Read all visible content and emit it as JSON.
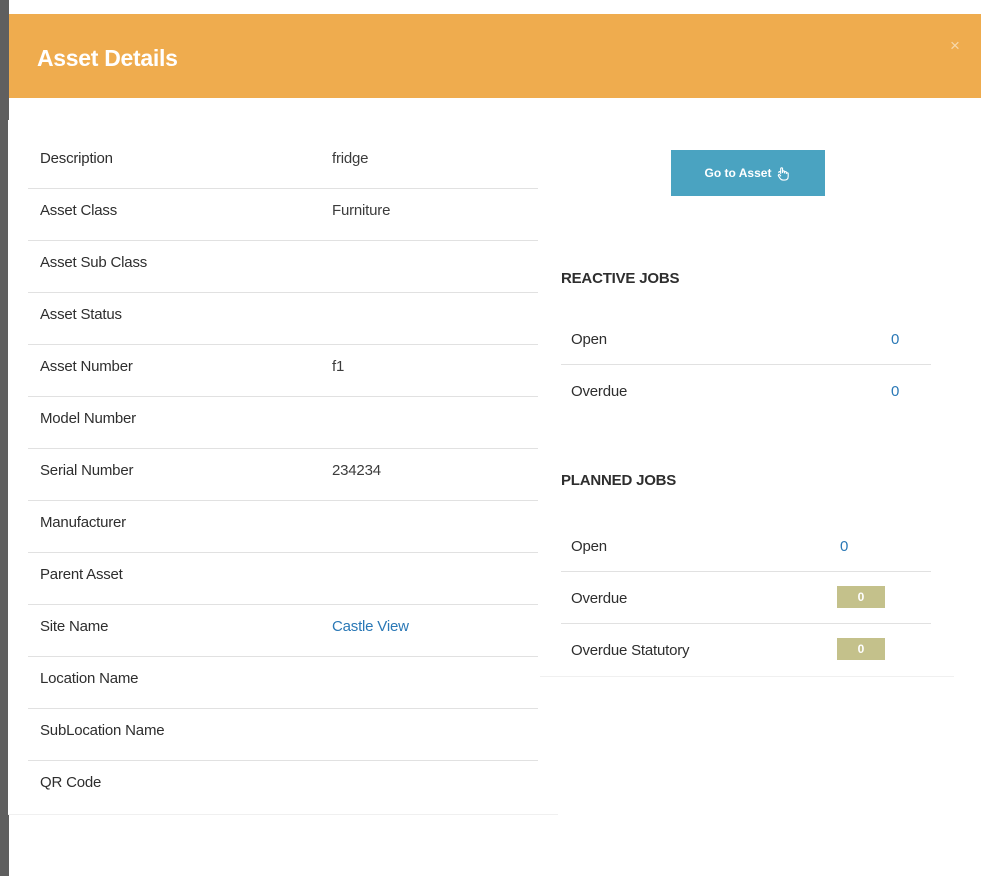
{
  "modal": {
    "title": "Asset Details",
    "close_label": "×"
  },
  "details": {
    "rows": [
      {
        "label": "Description",
        "value": "fridge"
      },
      {
        "label": "Asset Class",
        "value": "Furniture"
      },
      {
        "label": "Asset Sub Class",
        "value": ""
      },
      {
        "label": "Asset Status",
        "value": ""
      },
      {
        "label": "Asset Number",
        "value": "f1"
      },
      {
        "label": "Model Number",
        "value": ""
      },
      {
        "label": "Serial Number",
        "value": "234234"
      },
      {
        "label": "Manufacturer",
        "value": ""
      },
      {
        "label": "Parent Asset",
        "value": ""
      },
      {
        "label": "Site Name",
        "value": "Castle View"
      },
      {
        "label": "Location Name",
        "value": ""
      },
      {
        "label": "SubLocation Name",
        "value": ""
      },
      {
        "label": "QR Code",
        "value": ""
      }
    ]
  },
  "jobs": {
    "goto_label": "Go to Asset",
    "goto_icon": "hand-pointer-icon",
    "reactive": {
      "title": "REACTIVE JOBS",
      "rows": [
        {
          "label": "Open",
          "count": "0"
        },
        {
          "label": "Overdue",
          "count": "0"
        }
      ]
    },
    "planned": {
      "title": "PLANNED JOBS",
      "rows": [
        {
          "label": "Open",
          "count": "0"
        },
        {
          "label": "Overdue",
          "count": "0"
        },
        {
          "label": "Overdue Statutory",
          "count": "0"
        }
      ]
    }
  },
  "colors": {
    "header": "#efac4e",
    "button": "#4aa3c1",
    "link": "#2a78b6",
    "badge": "#c4c18b"
  }
}
